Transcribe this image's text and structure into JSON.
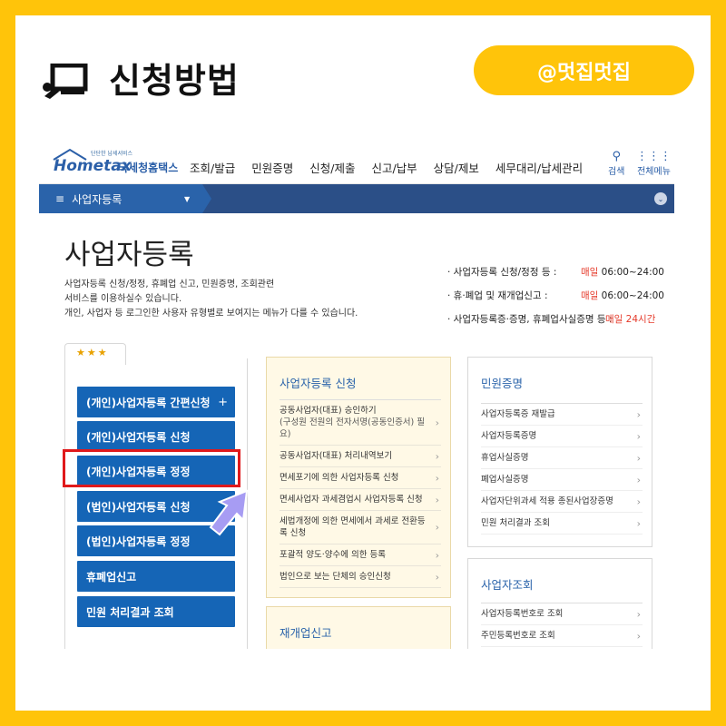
{
  "header": {
    "title": "신청방법",
    "handle": "@멋집멋집",
    "icon": "presentation-icon"
  },
  "colors": {
    "frame": "#ffc40a",
    "blue": "#1565b6",
    "nav": "#2b4f87",
    "red": "#e53a2a"
  },
  "site": {
    "logo_small": "단단한 납세서비스",
    "logo_main": "Hometax",
    "logo_sub": "국세청홈택스",
    "menu": [
      "조회/발급",
      "민원증명",
      "신청/제출",
      "신고/납부",
      "상담/제보",
      "세무대리/납세관리"
    ],
    "tools": {
      "search_label": "검색",
      "allmenu_label": "전체메뉴"
    },
    "breadcrumb": "사업자등록"
  },
  "page": {
    "title": "사업자등록",
    "desc": [
      "사업자등록 신청/정정, 휴폐업 신고, 민원증명, 조회관련",
      "서비스를 이용하실수 있습니다.",
      "개인, 사업자 등 로그인한 사용자 유형별로 보여지는 메뉴가 다를 수 있습니다."
    ],
    "hours": [
      {
        "label": "· 사업자등록 신청/정정 등 :",
        "day": "매일",
        "time": "06:00~24:00"
      },
      {
        "label": "· 휴·폐업 및 재개업신고 :",
        "day": "매일",
        "time": "06:00~24:00"
      },
      {
        "label": "· 사업자등록증·증명, 휴폐업사실증명 등 :",
        "day": "매일",
        "time": "24시간"
      }
    ]
  },
  "left": {
    "tab": "★★★",
    "buttons": [
      {
        "label": "(개인)사업자등록 간편신청",
        "plus": "+"
      },
      {
        "label": "(개인)사업자등록 신청"
      },
      {
        "label": "(개인)사업자등록 정정"
      },
      {
        "label": "(법인)사업자등록 신청"
      },
      {
        "label": "(법인)사업자등록 정정"
      },
      {
        "label": "휴폐업신고"
      },
      {
        "label": "민원 처리결과 조회"
      }
    ]
  },
  "middle": {
    "title": "사업자등록 신청",
    "items": [
      {
        "label": "공동사업자(대표) 승인하기",
        "sub": "(구성원 전원의 전자서명(공동인증서) 필요)"
      },
      {
        "label": "공동사업자(대표) 처리내역보기"
      },
      {
        "label": "면세포기에 의한 사업자등록 신청"
      },
      {
        "label": "면세사업자 과세겸업시 사업자등록 신청"
      },
      {
        "label": "세법개정에 의한 면세에서 과세로 전환등록 신청"
      },
      {
        "label": "포괄적 양도·양수에 의한 등록"
      },
      {
        "label": "법인으로 보는 단체의 승인신청"
      }
    ],
    "title2": "재개업신고"
  },
  "right": {
    "title": "민원증명",
    "items": [
      "사업자등록증 재발급",
      "사업자등록증명",
      "휴업사실증명",
      "폐업사실증명",
      "사업자단위과세 적용 종된사업장증명",
      "민원 처리결과 조회"
    ],
    "title2": "사업자조회",
    "items2": [
      "사업자등록번호로 조회",
      "주민등록번호로 조회"
    ]
  }
}
